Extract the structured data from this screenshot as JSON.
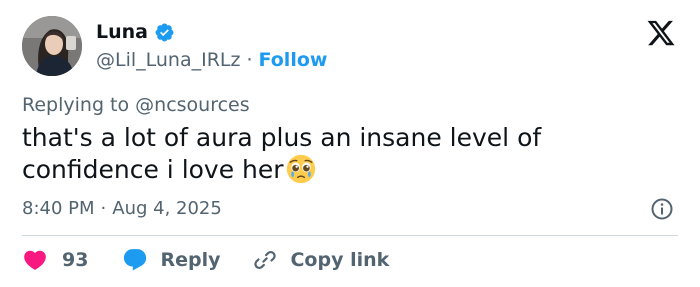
{
  "user": {
    "display_name": "Luna",
    "handle": "@Lil_Luna_IRLz",
    "separator": "·",
    "follow_label": "Follow",
    "verified_color": "#1d9bf0"
  },
  "brand": {
    "logo_icon": "x-logo-icon"
  },
  "tweet": {
    "replying_to": "Replying to @ncsources",
    "text": "that's a lot of aura plus an insane level of confidence i love her",
    "emoji": "pleading-face-emoji",
    "time": "8:40 PM",
    "meta_separator": "·",
    "date": "Aug 4, 2025"
  },
  "actions": {
    "like_count": "93",
    "reply_label": "Reply",
    "copy_link_label": "Copy link"
  },
  "colors": {
    "text": "#0f1419",
    "muted": "#536471",
    "accent": "#1d9bf0",
    "like": "#f91880",
    "divider": "#cfd9de"
  }
}
